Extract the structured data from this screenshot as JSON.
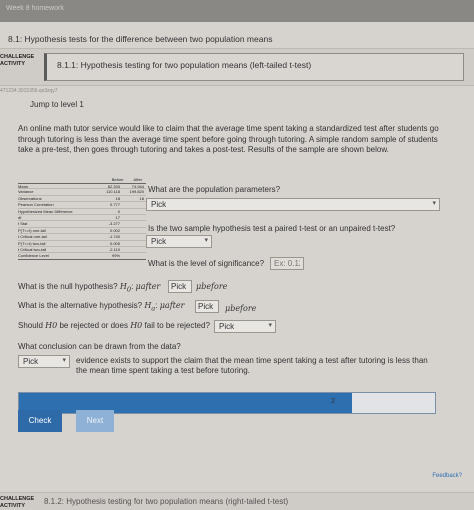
{
  "topbar": {
    "text": "Week 8 homework"
  },
  "section": {
    "title": "8.1: Hypothesis tests for the difference between two population means"
  },
  "challenge": {
    "tag": "CHALLENGE ACTIVITY",
    "title": "8.1.1: Hypothesis testing for two population means (left-tailed t-test)"
  },
  "id_line": "471234.3015356.qx3zqy7",
  "jump": "Jump to level 1",
  "problem": "An online math tutor service would like to claim that the average time spent taking a standardized test after students go through tutoring is less than the average time spent before going through tutoring. A simple random sample of students take a pre-test, then goes through tutoring and takes a post-test. Results of the sample are shown below.",
  "stats_table": {
    "headers": [
      "Before",
      "After"
    ],
    "rows": [
      [
        "Mean",
        "82.333",
        "74.944"
      ],
      [
        "Variance",
        "110.118",
        "199.820"
      ],
      [
        "Observations",
        "18",
        "18"
      ],
      [
        "Pearson Correlation",
        "0.777",
        ""
      ],
      [
        "Hypothesized Mean Difference",
        "0",
        ""
      ],
      [
        "df",
        "17",
        ""
      ],
      [
        "t Stat",
        "-3.277",
        ""
      ],
      [
        "P(T<=t) one-tail",
        "0.002",
        ""
      ],
      [
        "t Critical one-tail",
        "-1.740",
        ""
      ],
      [
        "P(T<=t) two-tail",
        "0.005",
        ""
      ],
      [
        "t Critical two-tail",
        "-2.110",
        ""
      ],
      [
        "Confidence Level",
        "99%",
        ""
      ]
    ]
  },
  "q1": {
    "text": "What are the population parameters?",
    "value": "Pick"
  },
  "q2": {
    "text": "Is the two sample hypothesis test a paired t-test or an unpaired t-test?",
    "value": "Pick"
  },
  "q3": {
    "text": "What is the level of significance?",
    "placeholder": "Ex: 0.12"
  },
  "q4": {
    "prefix": "What is the null hypothesis?",
    "h": "H",
    "sub": "0",
    "colon": ":",
    "mu_after": "μafter",
    "value": "Pick",
    "mu_before": "μbefore"
  },
  "q5": {
    "prefix": "What is the alternative hypothesis?",
    "h": "H",
    "sub": "a",
    "colon": ":",
    "mu_after": "μafter",
    "value": "Pick",
    "mu_before": "μbefore"
  },
  "q6": {
    "before": "Should",
    "h0": "H0",
    "mid": "be rejected or does",
    "h0b": "H0",
    "after": "fail to be rejected?",
    "value": "Pick"
  },
  "q7": {
    "text": "What conclusion can be drawn from the data?"
  },
  "conclusion": {
    "value": "Pick",
    "text": "evidence exists to support the claim that the mean time spent taking a test after tutoring is less than the mean time spent taking a test before tutoring."
  },
  "progress": {
    "count": "2",
    "fraction": 0.8
  },
  "buttons": {
    "check": "Check",
    "next": "Next"
  },
  "feedback": "Feedback?",
  "challenge2": {
    "tag": "CHALLENGE ACTIVITY",
    "title": "8.1.2: Hypothesis testing for two population means (right-tailed t-test)"
  },
  "colors": {
    "accent": "#2f6aa8",
    "progress_fill": "#2e6fb0",
    "next_disabled": "#8fb1d6"
  },
  "icons": {
    "dropdown": "chevron-down-icon"
  }
}
